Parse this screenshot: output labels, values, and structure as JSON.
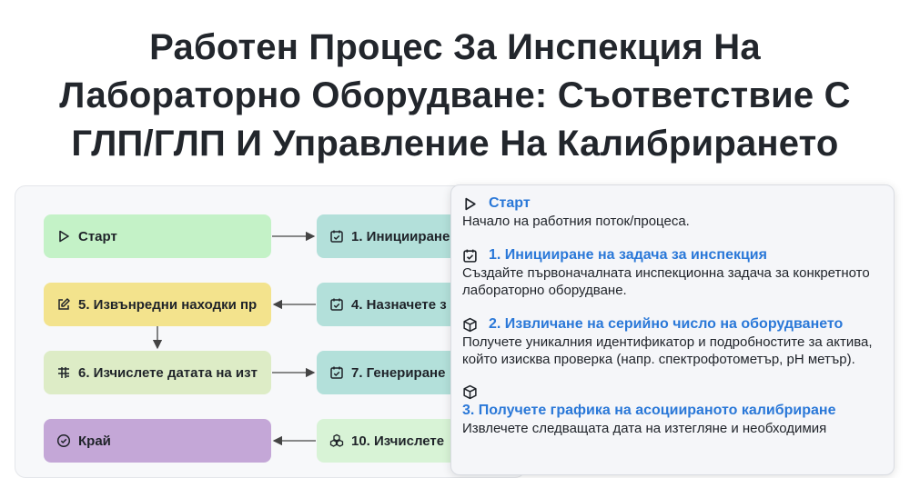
{
  "title": {
    "line1": "Работен Процес За Инспекция На",
    "line2": "Лабораторно Оборудване: Съответствие С",
    "line3": "ГЛП/ГЛП И Управление На Калибрирането"
  },
  "nodes": {
    "start": {
      "label": "Старт",
      "icon": "play-icon"
    },
    "n1": {
      "label": "1. Иницииране",
      "icon": "calendar-check-icon"
    },
    "n4": {
      "label": "4. Назначете з",
      "icon": "calendar-check-icon"
    },
    "n5": {
      "label": "5. Извънредни находки пр",
      "icon": "edit-icon"
    },
    "n6": {
      "label": "6. Изчислете датата на изт",
      "icon": "calculator-icon"
    },
    "n7": {
      "label": "7. Генериране",
      "icon": "calendar-check-icon"
    },
    "end": {
      "label": "Край",
      "icon": "check-circle-icon"
    },
    "n10": {
      "label": "10. Изчислете",
      "icon": "boxes-icon"
    }
  },
  "details": [
    {
      "title": "Старт",
      "icon": "play-icon",
      "desc": "Начало на работния поток/процеса."
    },
    {
      "title": "1. Иницииране на задача за инспекция",
      "icon": "calendar-check-icon",
      "desc": "Създайте първоначалната инспекционна задача за конкретното лабораторно оборудване."
    },
    {
      "title": "2. Извличане на серийно число на оборудването",
      "icon": "cube-icon",
      "desc": "Получете уникалния идентификатор и подробностите за актива, който изисква проверка (напр. спектрофотометър, pH метър)."
    },
    {
      "title": "3. Получете графика на асоциираното калибриране",
      "icon": "cube-icon",
      "desc": "Извлечете следващата дата на изтегляне и необходимия"
    }
  ],
  "colors": {
    "title": "#22262c",
    "start_node": "#c4f2c7",
    "task_node": "#b3e0da",
    "exception_node": "#f3e38d",
    "calc_node": "#ddecc6",
    "end_node": "#c4a7d7",
    "link": "#2a78d8"
  }
}
